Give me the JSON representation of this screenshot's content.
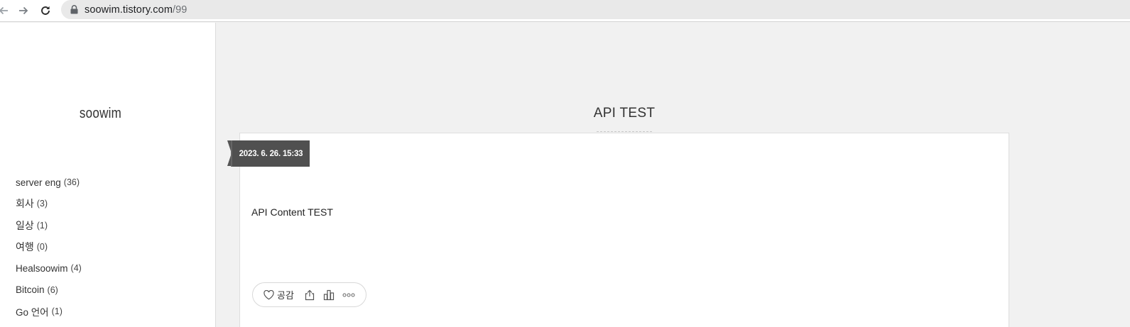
{
  "browser": {
    "url_host": "soowim.tistory.com",
    "url_path": "/99"
  },
  "sidebar": {
    "blog_title": "soowim",
    "categories": [
      {
        "label": "server eng",
        "count": "(36)"
      },
      {
        "label": "회사",
        "count": "(3)"
      },
      {
        "label": "일상",
        "count": "(1)"
      },
      {
        "label": "여행",
        "count": "(0)"
      },
      {
        "label": "Healsoowim",
        "count": "(4)"
      },
      {
        "label": "Bitcoin",
        "count": "(6)"
      },
      {
        "label": "Go 언어",
        "count": "(1)"
      }
    ]
  },
  "post": {
    "title": "API TEST",
    "date": "2023. 6. 26. 15:33",
    "content": "API Content TEST",
    "like_label": "공감"
  },
  "icons": {
    "back": "arrow-left-icon",
    "forward": "arrow-right-icon",
    "reload": "reload-icon",
    "lock": "lock-icon",
    "like": "heart-icon",
    "share": "share-icon",
    "stats": "bar-chart-icon",
    "more": "more-dots-icon"
  }
}
